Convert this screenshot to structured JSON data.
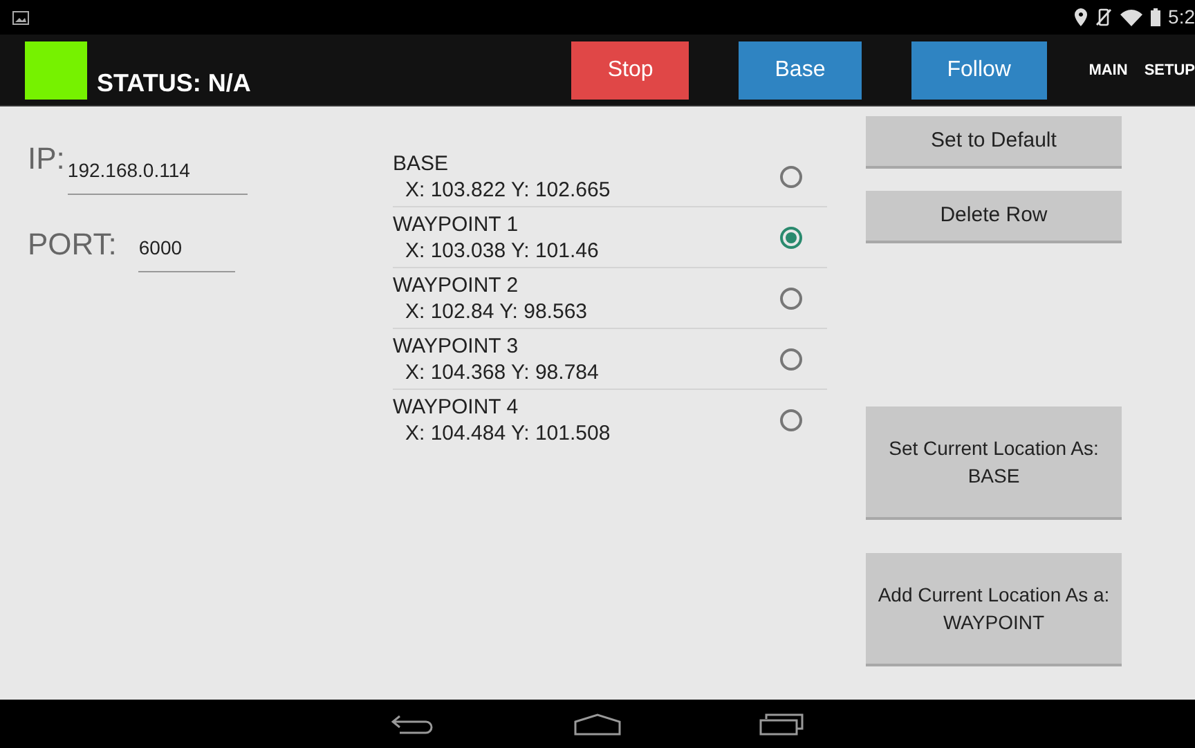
{
  "status_bar": {
    "time": "5:2"
  },
  "action_bar": {
    "status_indicator": {
      "color": "#76f200"
    },
    "status": "STATUS: N/A",
    "buttons": [
      {
        "label": "Stop",
        "color": "#e04747"
      },
      {
        "label": "Base",
        "color": "#2f84c2"
      },
      {
        "label": "Follow",
        "color": "#2f84c2"
      }
    ],
    "menu": [
      "MAIN",
      "SETUP"
    ]
  },
  "connection": {
    "ip_label": "IP:",
    "ip_value": "192.168.0.114",
    "port_label": "PORT:",
    "port_value": "6000"
  },
  "locations": [
    {
      "name": "BASE",
      "coords": "X: 103.822 Y: 102.665",
      "selected": false
    },
    {
      "name": "WAYPOINT 1",
      "coords": "X: 103.038 Y: 101.46",
      "selected": true
    },
    {
      "name": "WAYPOINT 2",
      "coords": "X: 102.84 Y: 98.563",
      "selected": false
    },
    {
      "name": "WAYPOINT 3",
      "coords": "X: 104.368 Y: 98.784",
      "selected": false
    },
    {
      "name": "WAYPOINT 4",
      "coords": "X: 104.484 Y: 101.508",
      "selected": false
    }
  ],
  "actions": {
    "top": [
      "Set to Default",
      "Delete Row"
    ],
    "bottom": [
      [
        "Set Current Location As:",
        "BASE"
      ],
      [
        "Add Current Location As a:",
        "WAYPOINT"
      ]
    ]
  }
}
